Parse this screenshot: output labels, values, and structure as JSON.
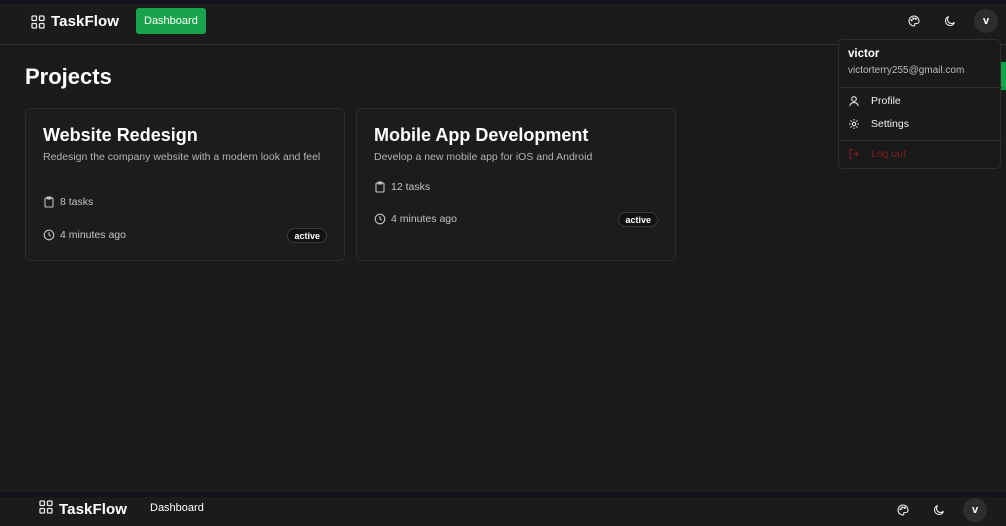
{
  "app": {
    "brand": "TaskFlow",
    "nav_dashboard": "Dashboard",
    "accent_color": "#16a34a"
  },
  "header": {
    "icons": [
      "palette-icon",
      "moon-icon"
    ],
    "avatar_letter": "v"
  },
  "page": {
    "title": "Projects"
  },
  "projects": [
    {
      "title": "Website Redesign",
      "description": "Redesign the company website with a modern look and feel",
      "tasks": "8 tasks",
      "updated": "4 minutes ago",
      "status": "active"
    },
    {
      "title": "Mobile App Development",
      "description": "Develop a new mobile app for iOS and Android",
      "tasks": "12 tasks",
      "updated": "4 minutes ago",
      "status": "active"
    }
  ],
  "user_menu": {
    "name": "victor",
    "email": "victorterry255@gmail.com",
    "items": [
      {
        "label": "Profile",
        "icon": "user-icon"
      },
      {
        "label": "Settings",
        "icon": "gear-icon"
      }
    ],
    "logout_label": "Log out",
    "logout_color": "#7f1d1d"
  },
  "footer_nav": {
    "brand": "TaskFlow",
    "dashboard": "Dashboard",
    "avatar_letter": "v"
  }
}
